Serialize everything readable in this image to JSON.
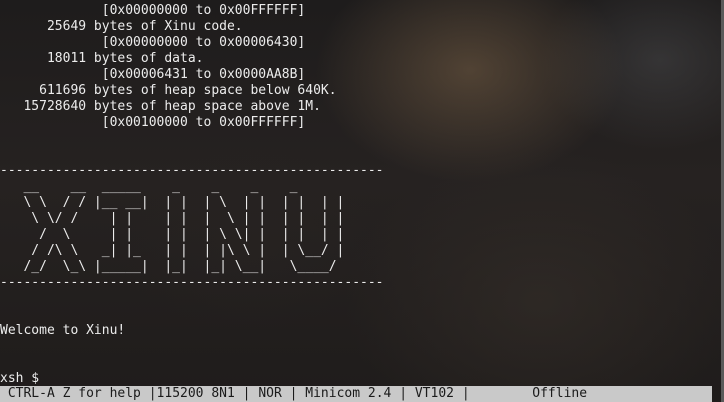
{
  "terminal": {
    "lines": [
      "             [0x00000000 to 0x00FFFFFF]",
      "      25649 bytes of Xinu code.",
      "             [0x00000000 to 0x00006430]",
      "      18011 bytes of data.",
      "             [0x00006431 to 0x0000AA8B]",
      "     611696 bytes of heap space below 640K.",
      "   15728640 bytes of heap space above 1M.",
      "             [0x00100000 to 0x00FFFFFF]",
      "",
      "",
      "-------------------------------------------------",
      "   __    __  _____    _    _    _    _",
      "   \\ \\  / / |__ __|  | |  | \\  | |  | |  | |",
      "    \\ \\/ /    | |    | |  |  \\ | |  | |  | |",
      "     /  \\     | |    | |  | \\ \\| |  | |  | |",
      "    / /\\ \\   _| |_   | |  | |\\ \\ |  | \\__/ |",
      "   /_/  \\_\\ |_____|  |_|  |_| \\__|   \\____/",
      "-------------------------------------------------",
      "",
      "",
      "Welcome to Xinu!",
      "",
      "",
      "xsh $ "
    ]
  },
  "statusbar": {
    "help": "CTRL-A Z for help",
    "serial": "115200 8N1",
    "mode": "NOR",
    "app": "Minicom 2.4",
    "term": "VT102",
    "state": "Offline"
  },
  "colors": {
    "text": "#ececec",
    "statusbar_bg": "#c9c9c9",
    "statusbar_fg": "#1a1a1a"
  }
}
